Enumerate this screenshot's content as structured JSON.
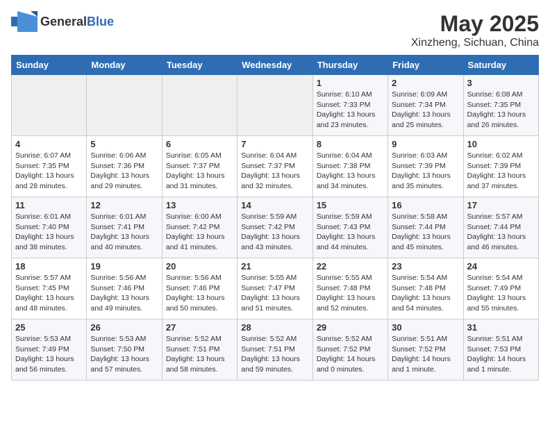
{
  "logo": {
    "general": "General",
    "blue": "Blue"
  },
  "header": {
    "month": "May 2025",
    "location": "Xinzheng, Sichuan, China"
  },
  "days_of_week": [
    "Sunday",
    "Monday",
    "Tuesday",
    "Wednesday",
    "Thursday",
    "Friday",
    "Saturday"
  ],
  "weeks": [
    [
      {
        "day": "",
        "info": ""
      },
      {
        "day": "",
        "info": ""
      },
      {
        "day": "",
        "info": ""
      },
      {
        "day": "",
        "info": ""
      },
      {
        "day": "1",
        "info": "Sunrise: 6:10 AM\nSunset: 7:33 PM\nDaylight: 13 hours\nand 23 minutes."
      },
      {
        "day": "2",
        "info": "Sunrise: 6:09 AM\nSunset: 7:34 PM\nDaylight: 13 hours\nand 25 minutes."
      },
      {
        "day": "3",
        "info": "Sunrise: 6:08 AM\nSunset: 7:35 PM\nDaylight: 13 hours\nand 26 minutes."
      }
    ],
    [
      {
        "day": "4",
        "info": "Sunrise: 6:07 AM\nSunset: 7:35 PM\nDaylight: 13 hours\nand 28 minutes."
      },
      {
        "day": "5",
        "info": "Sunrise: 6:06 AM\nSunset: 7:36 PM\nDaylight: 13 hours\nand 29 minutes."
      },
      {
        "day": "6",
        "info": "Sunrise: 6:05 AM\nSunset: 7:37 PM\nDaylight: 13 hours\nand 31 minutes."
      },
      {
        "day": "7",
        "info": "Sunrise: 6:04 AM\nSunset: 7:37 PM\nDaylight: 13 hours\nand 32 minutes."
      },
      {
        "day": "8",
        "info": "Sunrise: 6:04 AM\nSunset: 7:38 PM\nDaylight: 13 hours\nand 34 minutes."
      },
      {
        "day": "9",
        "info": "Sunrise: 6:03 AM\nSunset: 7:39 PM\nDaylight: 13 hours\nand 35 minutes."
      },
      {
        "day": "10",
        "info": "Sunrise: 6:02 AM\nSunset: 7:39 PM\nDaylight: 13 hours\nand 37 minutes."
      }
    ],
    [
      {
        "day": "11",
        "info": "Sunrise: 6:01 AM\nSunset: 7:40 PM\nDaylight: 13 hours\nand 38 minutes."
      },
      {
        "day": "12",
        "info": "Sunrise: 6:01 AM\nSunset: 7:41 PM\nDaylight: 13 hours\nand 40 minutes."
      },
      {
        "day": "13",
        "info": "Sunrise: 6:00 AM\nSunset: 7:42 PM\nDaylight: 13 hours\nand 41 minutes."
      },
      {
        "day": "14",
        "info": "Sunrise: 5:59 AM\nSunset: 7:42 PM\nDaylight: 13 hours\nand 43 minutes."
      },
      {
        "day": "15",
        "info": "Sunrise: 5:59 AM\nSunset: 7:43 PM\nDaylight: 13 hours\nand 44 minutes."
      },
      {
        "day": "16",
        "info": "Sunrise: 5:58 AM\nSunset: 7:44 PM\nDaylight: 13 hours\nand 45 minutes."
      },
      {
        "day": "17",
        "info": "Sunrise: 5:57 AM\nSunset: 7:44 PM\nDaylight: 13 hours\nand 46 minutes."
      }
    ],
    [
      {
        "day": "18",
        "info": "Sunrise: 5:57 AM\nSunset: 7:45 PM\nDaylight: 13 hours\nand 48 minutes."
      },
      {
        "day": "19",
        "info": "Sunrise: 5:56 AM\nSunset: 7:46 PM\nDaylight: 13 hours\nand 49 minutes."
      },
      {
        "day": "20",
        "info": "Sunrise: 5:56 AM\nSunset: 7:46 PM\nDaylight: 13 hours\nand 50 minutes."
      },
      {
        "day": "21",
        "info": "Sunrise: 5:55 AM\nSunset: 7:47 PM\nDaylight: 13 hours\nand 51 minutes."
      },
      {
        "day": "22",
        "info": "Sunrise: 5:55 AM\nSunset: 7:48 PM\nDaylight: 13 hours\nand 52 minutes."
      },
      {
        "day": "23",
        "info": "Sunrise: 5:54 AM\nSunset: 7:48 PM\nDaylight: 13 hours\nand 54 minutes."
      },
      {
        "day": "24",
        "info": "Sunrise: 5:54 AM\nSunset: 7:49 PM\nDaylight: 13 hours\nand 55 minutes."
      }
    ],
    [
      {
        "day": "25",
        "info": "Sunrise: 5:53 AM\nSunset: 7:49 PM\nDaylight: 13 hours\nand 56 minutes."
      },
      {
        "day": "26",
        "info": "Sunrise: 5:53 AM\nSunset: 7:50 PM\nDaylight: 13 hours\nand 57 minutes."
      },
      {
        "day": "27",
        "info": "Sunrise: 5:52 AM\nSunset: 7:51 PM\nDaylight: 13 hours\nand 58 minutes."
      },
      {
        "day": "28",
        "info": "Sunrise: 5:52 AM\nSunset: 7:51 PM\nDaylight: 13 hours\nand 59 minutes."
      },
      {
        "day": "29",
        "info": "Sunrise: 5:52 AM\nSunset: 7:52 PM\nDaylight: 14 hours\nand 0 minutes."
      },
      {
        "day": "30",
        "info": "Sunrise: 5:51 AM\nSunset: 7:52 PM\nDaylight: 14 hours\nand 1 minute."
      },
      {
        "day": "31",
        "info": "Sunrise: 5:51 AM\nSunset: 7:53 PM\nDaylight: 14 hours\nand 1 minute."
      }
    ]
  ]
}
